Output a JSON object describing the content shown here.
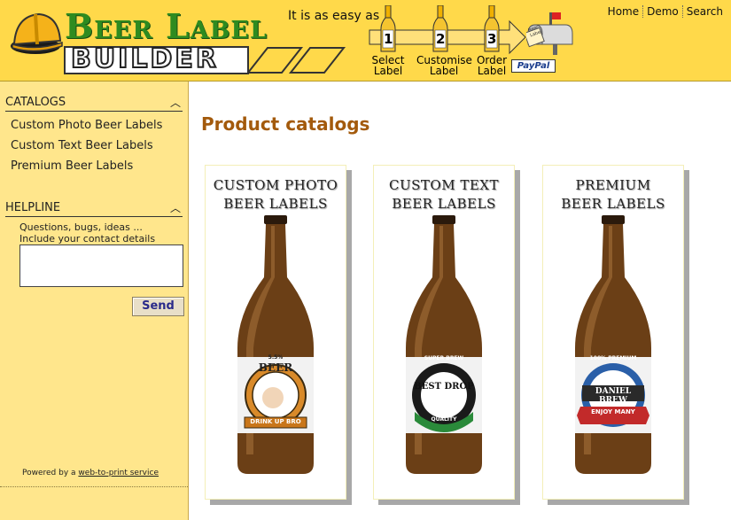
{
  "header": {
    "logo_top": "Beer Label",
    "logo_bottom": "BUILDER",
    "easy_text": "It is as easy as",
    "steps": [
      {
        "num": "1",
        "label_line1": "Select",
        "label_line2": "Label"
      },
      {
        "num": "2",
        "label_line1": "Customise",
        "label_line2": "Label"
      },
      {
        "num": "3",
        "label_line1": "Order",
        "label_line2": "Label"
      }
    ],
    "paypal": "PayPal",
    "mailbox_tag": "Beer Label",
    "nav": {
      "home": "Home",
      "demo": "Demo",
      "search": "Search"
    }
  },
  "sidebar": {
    "catalogs_heading": "CATALOGS",
    "catalog_items": [
      "Custom Photo Beer Labels",
      "Custom Text Beer Labels",
      "Premium Beer Labels"
    ],
    "helpline_heading": "HELPLINE",
    "help_line1": "Questions, bugs, ideas ...",
    "help_line2": "Include your contact details",
    "send_label": "Send",
    "powered_prefix": "Powered by a",
    "powered_link": "web-to-print service"
  },
  "main": {
    "title": "Product catalogs",
    "cards": [
      {
        "title1": "CUSTOM PHOTO",
        "title2": "BEER LABELS",
        "label_top": "5.5%",
        "label_main": "BEER",
        "label_ribbon": "DRINK UP BRO"
      },
      {
        "title1": "CUSTOM TEXT",
        "title2": "BEER LABELS",
        "label_top": "SUPER BREW",
        "label_main": "BEST DROP",
        "label_ribbon": "QUALITY"
      },
      {
        "title1": "PREMIUM",
        "title2": "BEER LABELS",
        "label_top": "100% PREMIUM",
        "label_main": "DANIEL BREW",
        "label_ribbon": "ENJOY MANY"
      }
    ]
  },
  "colors": {
    "header_bg": "#ffd94a",
    "sidebar_bg": "#ffe68c",
    "title": "#a35a0c",
    "logo_green": "#2e8b20"
  }
}
